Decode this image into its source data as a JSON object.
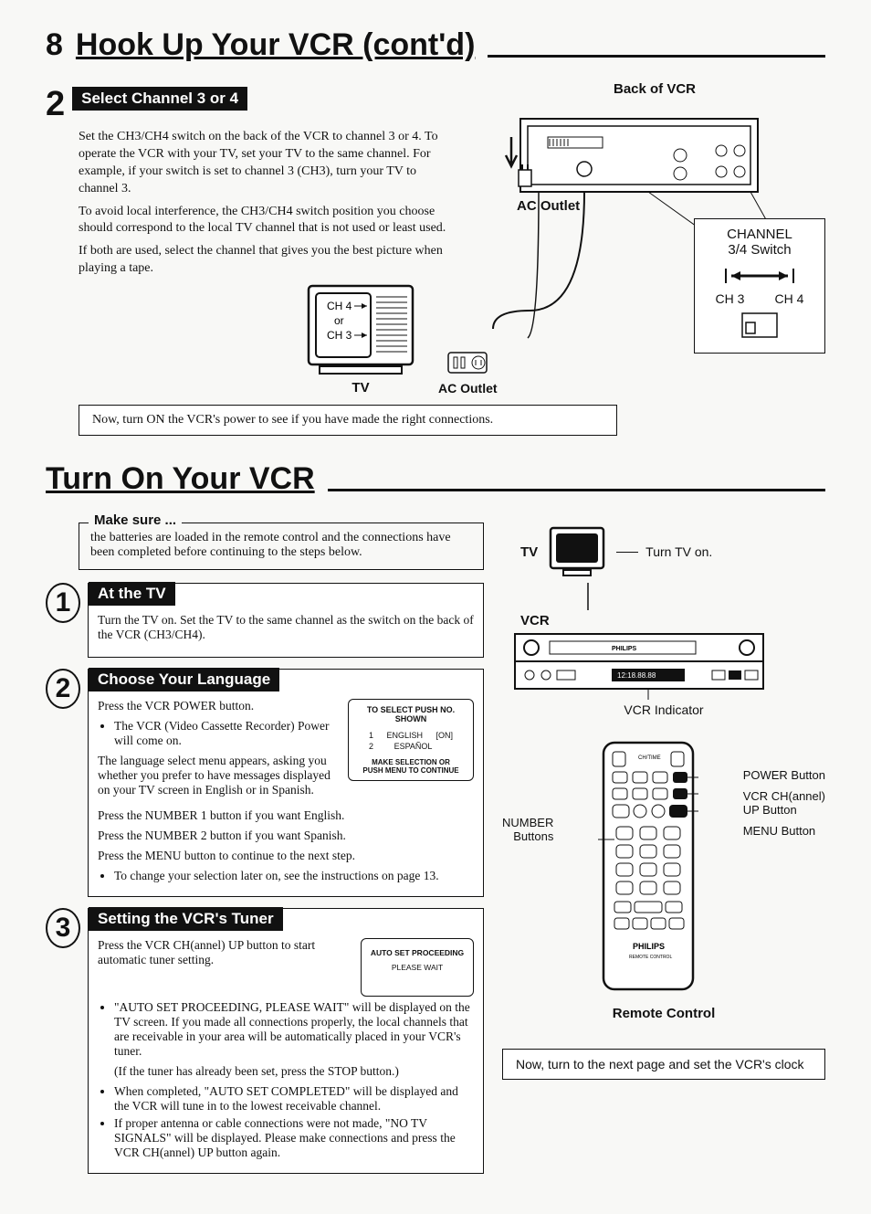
{
  "page": {
    "number": "8",
    "title1": "Hook Up Your VCR (cont'd)",
    "title2": "Turn On Your VCR"
  },
  "s2": {
    "num": "2",
    "label": "Select Channel 3 or 4",
    "p1": "Set the CH3/CH4 switch on the back of the VCR to channel 3 or 4. To operate the VCR with your TV, set your TV to the same channel. For example, if your switch is set to channel 3 (CH3), turn your TV to channel 3.",
    "p2": "To avoid local interference, the CH3/CH4 switch position you choose should correspond to the local TV channel that is not used or least used.",
    "p3": "If both are used, select the channel that gives you the best picture when playing a tape.",
    "callout": "Now, turn ON the VCR's power to see if you have made the right connections."
  },
  "diag1": {
    "back_of_vcr": "Back of VCR",
    "ac_outlet": "AC Outlet",
    "channel_switch": "CHANNEL\n3/4 Switch",
    "ch3": "CH 3",
    "ch4": "CH 4",
    "tv": "TV",
    "tv_ch4": "CH 4",
    "tv_or": "or",
    "tv_ch3": "CH 3"
  },
  "makesure": {
    "legend": "Make sure ...",
    "text": "the batteries are loaded in the remote control and the connections have been completed before continuing to the steps below."
  },
  "step1": {
    "num": "1",
    "label": "At the TV",
    "p1": "Turn the TV on. Set the TV to the same channel as the switch on the back of the VCR (CH3/CH4)."
  },
  "step2": {
    "num": "2",
    "label": "Choose Your Language",
    "p1": "Press the VCR POWER button.",
    "b1": "The VCR (Video Cassette Recorder) Power will come on.",
    "p2": "The language select menu appears, asking you whether you prefer to have messages displayed on your TV screen in English or in Spanish.",
    "p3": "Press the NUMBER 1 button if you want English.",
    "p4": "Press the NUMBER 2 button if you want Spanish.",
    "p5": "Press the MENU button to continue to the next step.",
    "b2": "To change your selection later on, see the instructions on page 13.",
    "osd": {
      "title": "TO SELECT PUSH NO. SHOWN",
      "row1_num": "1",
      "row1_lang": "ENGLISH",
      "row1_state": "[ON]",
      "row2_num": "2",
      "row2_lang": "ESPAÑOL",
      "footer": "MAKE SELECTION OR\nPUSH MENU TO CONTINUE"
    }
  },
  "step3": {
    "num": "3",
    "label": "Setting the VCR's Tuner",
    "p1": "Press the VCR CH(annel) UP button to start automatic tuner setting.",
    "b1": "\"AUTO SET PROCEEDING, PLEASE WAIT\" will be displayed on the TV screen. If you made all connections properly, the local channels that are receivable in your area will be automatically placed in your VCR's tuner.",
    "paren": "(If the tuner has already been set, press the STOP button.)",
    "b2": "When completed, \"AUTO SET COMPLETED\" will be displayed and the VCR will tune in to the lowest receivable channel.",
    "b3": "If proper antenna or cable connections were not made, \"NO TV SIGNALS\" will be displayed. Please make connections and press the VCR CH(annel) UP button again.",
    "osd": {
      "line1": "AUTO SET PROCEEDING",
      "line2": "PLEASE WAIT"
    }
  },
  "diag2": {
    "tv": "TV",
    "turn_tv_on": "Turn TV on.",
    "vcr": "VCR",
    "vcr_indicator": "VCR Indicator",
    "remote_title": "Remote Control",
    "remote_brand": "PHILIPS",
    "remote_sub": "REMOTE CONTROL",
    "number_buttons": "NUMBER\nButtons",
    "power_btn": "POWER Button",
    "ch_up_btn": "VCR CH(annel)\nUP Button",
    "menu_btn": "MENU Button",
    "final_note": "Now, turn to the next page and set the VCR's clock"
  }
}
